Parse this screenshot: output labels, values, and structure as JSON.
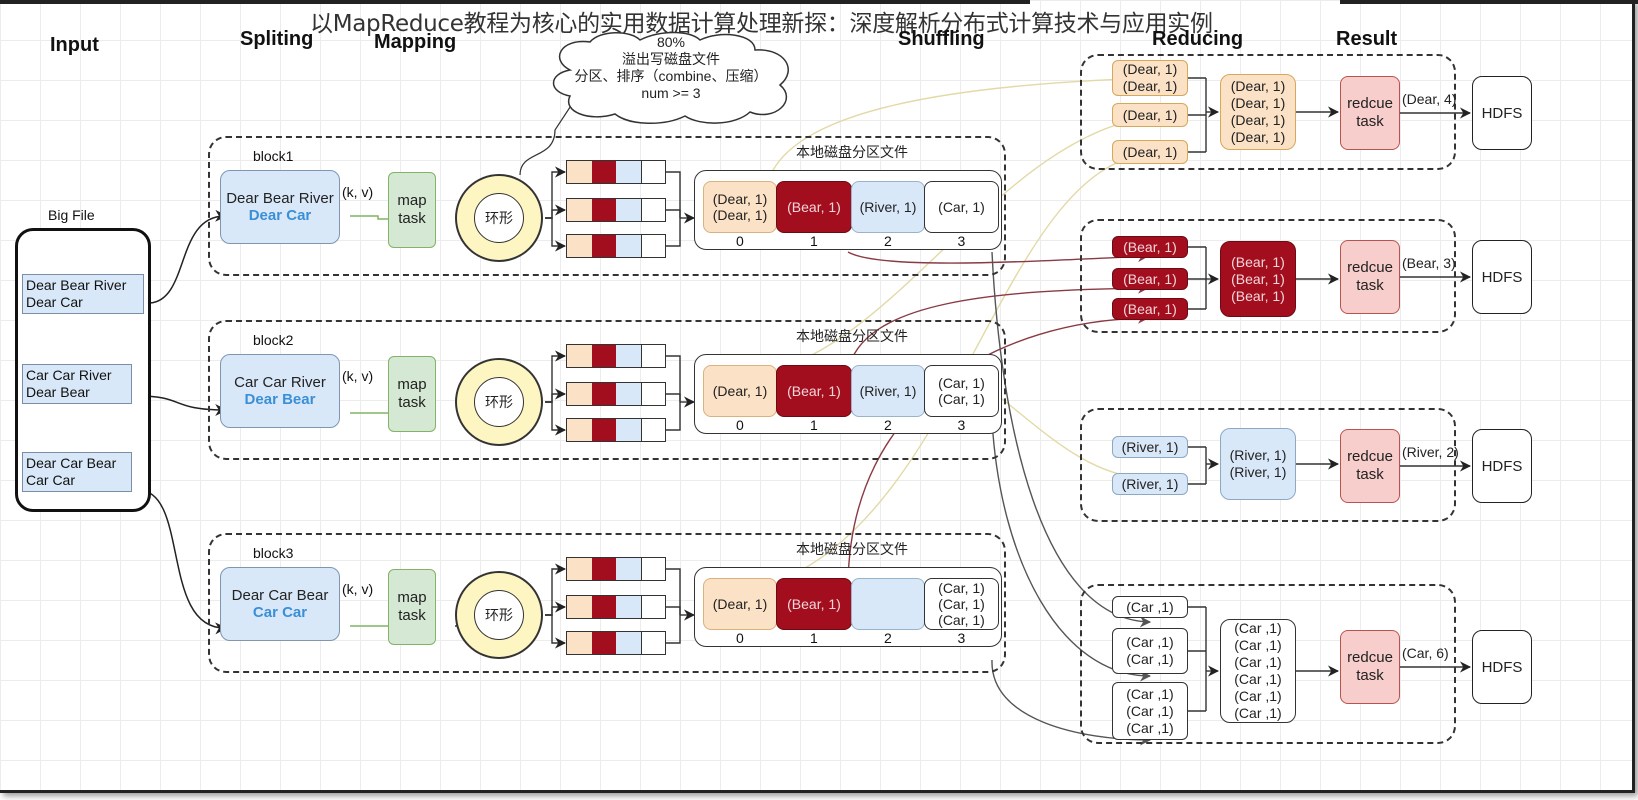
{
  "title": "以MapReduce教程为核心的实用数据计算处理新探：深度解析分布式计算技术与应用实例",
  "stages": {
    "input": "Input",
    "splitting": "Spliting",
    "mapping": "Mapping",
    "shuffling": "Shuffling",
    "reducing": "Reducing",
    "result": "Result"
  },
  "spill_note": {
    "line1": "80%",
    "line2": "溢出写磁盘文件",
    "line3": "分区、排序（combine、压缩）",
    "line4": "num >= 3"
  },
  "big_file": {
    "label": "Big File",
    "splits": [
      {
        "line1": "Dear Bear River",
        "line2": "Dear Car"
      },
      {
        "line1": "Car Car River",
        "line2": "Dear Bear"
      },
      {
        "line1": "Dear Car Bear",
        "line2": "Car Car"
      }
    ]
  },
  "blocks": [
    {
      "name": "block1",
      "line1": "Dear Bear River",
      "line2": "Dear Car",
      "kv": "(k, v)",
      "map_line1": "map",
      "map_line2": "task",
      "ring": "环形",
      "partition_title": "本地磁盘分区文件",
      "partitions": [
        {
          "index": "0",
          "lines": [
            "(Dear, 1)",
            "(Dear, 1)"
          ]
        },
        {
          "index": "1",
          "lines": [
            "(Bear, 1)"
          ]
        },
        {
          "index": "2",
          "lines": [
            "(River, 1)"
          ]
        },
        {
          "index": "3",
          "lines": [
            "(Car, 1)"
          ]
        }
      ]
    },
    {
      "name": "block2",
      "line1": "Car Car River",
      "line2": "Dear Bear",
      "kv": "(k, v)",
      "map_line1": "map",
      "map_line2": "task",
      "ring": "环形",
      "partition_title": "本地磁盘分区文件",
      "partitions": [
        {
          "index": "0",
          "lines": [
            "(Dear, 1)"
          ]
        },
        {
          "index": "1",
          "lines": [
            "(Bear, 1)"
          ]
        },
        {
          "index": "2",
          "lines": [
            "(River, 1)"
          ]
        },
        {
          "index": "3",
          "lines": [
            "(Car, 1)",
            "(Car, 1)"
          ]
        }
      ]
    },
    {
      "name": "block3",
      "line1": "Dear Car Bear",
      "line2": "Car Car",
      "kv": "(k, v)",
      "map_line1": "map",
      "map_line2": "task",
      "ring": "环形",
      "partition_title": "本地磁盘分区文件",
      "partitions": [
        {
          "index": "0",
          "lines": [
            "(Dear, 1)"
          ]
        },
        {
          "index": "1",
          "lines": [
            "(Bear, 1)"
          ]
        },
        {
          "index": "2",
          "lines": []
        },
        {
          "index": "3",
          "lines": [
            "(Car, 1)",
            "(Car, 1)",
            "(Car, 1)"
          ]
        }
      ]
    }
  ],
  "reducers": [
    {
      "key": "dear",
      "inputs": [
        [
          "(Dear, 1)",
          "(Dear, 1)"
        ],
        [
          "(Dear, 1)"
        ],
        [
          "(Dear, 1)"
        ]
      ],
      "merged": [
        "(Dear, 1)",
        "(Dear, 1)",
        "(Dear, 1)",
        "(Dear, 1)"
      ],
      "task_line1": "redcue",
      "task_line2": "task",
      "output": "(Dear, 4)",
      "sink": "HDFS"
    },
    {
      "key": "bear",
      "inputs": [
        [
          "(Bear, 1)"
        ],
        [
          "(Bear, 1)"
        ],
        [
          "(Bear, 1)"
        ]
      ],
      "merged": [
        "(Bear, 1)",
        "(Bear, 1)",
        "(Bear, 1)"
      ],
      "task_line1": "redcue",
      "task_line2": "task",
      "output": "(Bear, 3)",
      "sink": "HDFS"
    },
    {
      "key": "river",
      "inputs": [
        [
          "(River, 1)"
        ],
        [
          "(River, 1)"
        ]
      ],
      "merged": [
        "(River, 1)",
        "(River, 1)"
      ],
      "task_line1": "redcue",
      "task_line2": "task",
      "output": "(River, 2)",
      "sink": "HDFS"
    },
    {
      "key": "car",
      "inputs": [
        [
          "(Car ,1)"
        ],
        [
          "(Car ,1)",
          "(Car ,1)"
        ],
        [
          "(Car ,1)",
          "(Car ,1)",
          "(Car ,1)"
        ]
      ],
      "merged": [
        "(Car ,1)",
        "(Car ,1)",
        "(Car ,1)",
        "(Car ,1)",
        "(Car ,1)",
        "(Car ,1)"
      ],
      "task_line1": "redcue",
      "task_line2": "task",
      "output": "(Car, 6)",
      "sink": "HDFS"
    }
  ],
  "colors": {
    "dear": "#fbe1c5",
    "bear": "#a20e1e",
    "river": "#d8e8f8",
    "car": "#ffffff",
    "map_task": "#d5e8d4",
    "ring": "#fdf6c3",
    "reduce_task": "#f8cecc"
  }
}
